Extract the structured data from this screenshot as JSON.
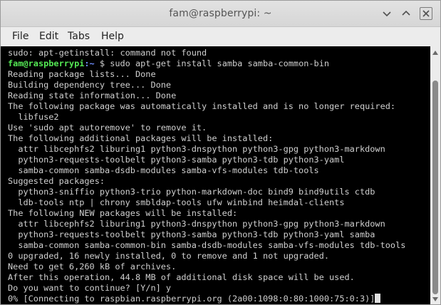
{
  "window": {
    "title": "fam@raspberrypi: ~"
  },
  "menu": {
    "items": [
      "File",
      "Edit",
      "Tabs",
      "Help"
    ]
  },
  "terminal": {
    "prompt_user": "fam@raspberrypi",
    "prompt_path": ":~",
    "prompt_symbol": " $ ",
    "lines": [
      "sudo: apt-getinstall: command not found",
      "sudo apt-get install samba samba-common-bin",
      "Reading package lists... Done",
      "Building dependency tree... Done",
      "Reading state information... Done",
      "The following package was automatically installed and is no longer required:",
      "  libfuse2",
      "Use 'sudo apt autoremove' to remove it.",
      "The following additional packages will be installed:",
      "  attr libcephfs2 liburing1 python3-dnspython python3-gpg python3-markdown",
      "  python3-requests-toolbelt python3-samba python3-tdb python3-yaml",
      "  samba-common samba-dsdb-modules samba-vfs-modules tdb-tools",
      "Suggested packages:",
      "  python3-sniffio python3-trio python-markdown-doc bind9 bind9utils ctdb",
      "  ldb-tools ntp | chrony smbldap-tools ufw winbind heimdal-clients",
      "The following NEW packages will be installed:",
      "  attr libcephfs2 liburing1 python3-dnspython python3-gpg python3-markdown",
      "  python3-requests-toolbelt python3-samba python3-tdb python3-yaml samba",
      "  samba-common samba-common-bin samba-dsdb-modules samba-vfs-modules tdb-tools",
      "0 upgraded, 16 newly installed, 0 to remove and 1 not upgraded.",
      "Need to get 6,260 kB of archives.",
      "After this operation, 44.8 MB of additional disk space will be used.",
      "Do you want to continue? [Y/n] y",
      "0% [Connecting to raspbian.raspberrypi.org (2a00:1098:0:80:1000:75:0:3)]"
    ]
  }
}
